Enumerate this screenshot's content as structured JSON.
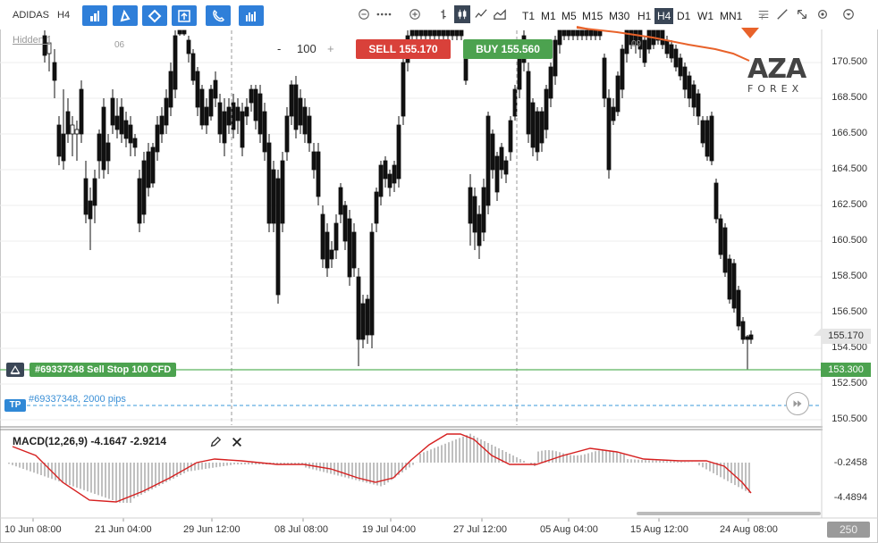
{
  "toolbar": {
    "symbol": "ADIDAS",
    "period": "H4",
    "timeframes": [
      "T1",
      "M1",
      "M5",
      "M15",
      "M30",
      "H1",
      "H4",
      "D1",
      "W1",
      "MN1"
    ],
    "active_timeframe": "H4"
  },
  "chart": {
    "hidden_label": "Hidden 1",
    "marker_06": "06",
    "marker_09": "09",
    "quantity": "100",
    "qty_minus": "-",
    "qty_plus": "+",
    "sell_label": "SELL 155.170",
    "buy_label": "BUY 155.560",
    "order_label": "#69337348 Sell Stop 100 CFD",
    "tp_badge": "TP",
    "tp_label": "#69337348, 2000 pips",
    "order_price": "153.300",
    "current_price": "155.170",
    "y_labels": [
      "170.500",
      "168.500",
      "166.500",
      "164.500",
      "162.500",
      "160.500",
      "158.500",
      "156.500",
      "154.500",
      "152.500",
      "150.500"
    ],
    "x_labels": [
      "10 Jun 08:00",
      "21 Jun 04:00",
      "29 Jun 12:00",
      "08 Jul 08:00",
      "19 Jul 04:00",
      "27 Jul 12:00",
      "05 Aug 04:00",
      "15 Aug 12:00",
      "24 Aug 08:00"
    ],
    "macd_label": "MACD(12,26,9) -4.1647 -2.9214",
    "macd_y_labels": [
      "-0.2458",
      "-4.4894"
    ],
    "zoom_value": "250",
    "logo_main": "AZA",
    "logo_sub": "FOREX"
  },
  "colors": {
    "accent": "#2f7fd9",
    "sell": "#d9413a",
    "buy": "#4ca24f",
    "ma_line": "#e8622a",
    "macd_signal": "#d62020"
  }
}
